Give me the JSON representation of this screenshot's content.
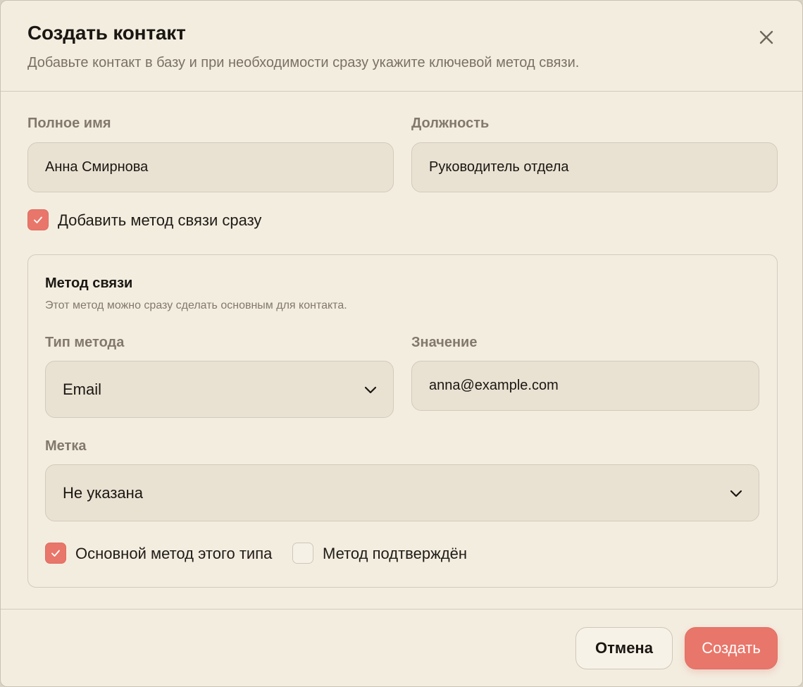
{
  "dialog": {
    "title": "Создать контакт",
    "subtitle": "Добавьте контакт в базу и при необходимости сразу укажите ключевой метод связи."
  },
  "form": {
    "full_name": {
      "label": "Полное имя",
      "value": "Анна Смирнова"
    },
    "position": {
      "label": "Должность",
      "value": "Руководитель отдела"
    },
    "add_method": {
      "label": "Добавить метод связи сразу",
      "checked": true
    }
  },
  "method": {
    "title": "Метод связи",
    "subtitle": "Этот метод можно сразу сделать основным для контакта.",
    "type": {
      "label": "Тип метода",
      "value": "Email"
    },
    "value_field": {
      "label": "Значение",
      "value": "anna@example.com"
    },
    "tag": {
      "label": "Метка",
      "value": "Не указана"
    },
    "primary": {
      "label": "Основной метод этого типа",
      "checked": true
    },
    "verified": {
      "label": "Метод подтверждён",
      "checked": false
    }
  },
  "footer": {
    "cancel_label": "Отмена",
    "create_label": "Создать"
  },
  "colors": {
    "background": "#f3ede0",
    "accent": "#e9766a",
    "field_bg": "#e9e2d3"
  },
  "icons": {
    "close": "close-icon",
    "check": "check-icon",
    "chevron": "chevron-down-icon"
  }
}
